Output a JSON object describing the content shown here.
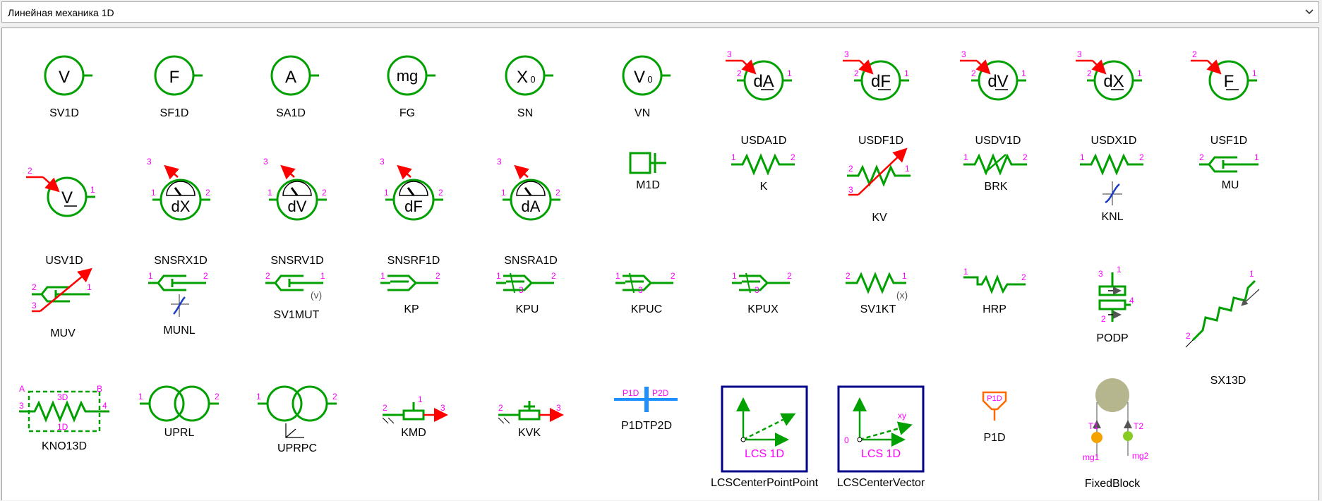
{
  "library_select": {
    "value": "Линейная механика 1D"
  },
  "colors": {
    "wire": "#00a000",
    "pin": "#ff00ff",
    "signal": "#ff0000",
    "frame": "#00008b",
    "lcs": "#ff00ff"
  },
  "components": [
    {
      "label": "SV1D",
      "sym": "V"
    },
    {
      "label": "SF1D",
      "sym": "F"
    },
    {
      "label": "SA1D",
      "sym": "A"
    },
    {
      "label": "FG",
      "sym": "mg"
    },
    {
      "label": "SN",
      "sym": "X",
      "sub": "0"
    },
    {
      "label": "VN",
      "sym": "V",
      "sub": "0"
    },
    {
      "label": "USDA1D",
      "sym": "dA",
      "pins": [
        "3",
        "2",
        "1"
      ]
    },
    {
      "label": "USDF1D",
      "sym": "dF",
      "pins": [
        "3",
        "2",
        "1"
      ]
    },
    {
      "label": "USDV1D",
      "sym": "dV",
      "pins": [
        "3",
        "2",
        "1"
      ]
    },
    {
      "label": "USDX1D",
      "sym": "dX",
      "pins": [
        "3",
        "2",
        "1"
      ]
    },
    {
      "label": "USF1D",
      "sym": "F",
      "pins": [
        "2",
        "1"
      ]
    },
    {
      "label": "USV1D",
      "sym": "V",
      "pins": [
        "2",
        "1"
      ]
    },
    {
      "label": "SNSRX1D",
      "sym": "dX",
      "pins": [
        "3",
        "1",
        "2"
      ]
    },
    {
      "label": "SNSRV1D",
      "sym": "dV",
      "pins": [
        "3",
        "1",
        "2"
      ]
    },
    {
      "label": "SNSRF1D",
      "sym": "dF",
      "pins": [
        "3",
        "1",
        "2"
      ]
    },
    {
      "label": "SNSRA1D",
      "sym": "dA",
      "pins": [
        "3",
        "1",
        "2"
      ]
    },
    {
      "label": "M1D"
    },
    {
      "label": "K",
      "pins": [
        "1",
        "2"
      ]
    },
    {
      "label": "KV",
      "pins": [
        "2",
        "1",
        "3"
      ]
    },
    {
      "label": "BRK",
      "pins": [
        "1",
        "2"
      ]
    },
    {
      "label": "KNL",
      "pins": [
        "1",
        "2"
      ]
    },
    {
      "label": "MU",
      "pins": [
        "2",
        "1"
      ]
    },
    {
      "label": "MUV",
      "pins": [
        "2",
        "1",
        "3"
      ]
    },
    {
      "label": "MUNL",
      "pins": [
        "1",
        "2"
      ]
    },
    {
      "label": "SV1MUT",
      "pins": [
        "2",
        "1"
      ],
      "sym": "(v)"
    },
    {
      "label": "KP",
      "pins": [
        "1",
        "2"
      ]
    },
    {
      "label": "KPU",
      "pins": [
        "1",
        "3",
        "2"
      ]
    },
    {
      "label": "KPUC",
      "pins": [
        "1",
        "3",
        "2"
      ]
    },
    {
      "label": "KPUX",
      "pins": [
        "1",
        "3",
        "2"
      ]
    },
    {
      "label": "SV1KT",
      "pins": [
        "2",
        "1"
      ],
      "sym": "(x)"
    },
    {
      "label": "HRP",
      "pins": [
        "1",
        "2"
      ]
    },
    {
      "label": "PODP",
      "pins": [
        "3",
        "1",
        "4",
        "2"
      ]
    },
    {
      "label": "SX13D",
      "pins": [
        "1",
        "2"
      ]
    },
    {
      "label": "KNO13D",
      "pins": [
        "A",
        "B",
        "3D",
        "3",
        "4",
        "1D"
      ]
    },
    {
      "label": "UPRL",
      "pins": [
        "1",
        "2"
      ]
    },
    {
      "label": "UPRPC",
      "pins": [
        "1",
        "2"
      ]
    },
    {
      "label": "KMD",
      "pins": [
        "2",
        "1",
        "3"
      ]
    },
    {
      "label": "KVK",
      "pins": [
        "2",
        "3"
      ]
    },
    {
      "label": "P1DTP2D",
      "pins": [
        "P1D",
        "P2D"
      ]
    },
    {
      "label": "LCSCenterPointPoint",
      "sym": "LCS 1D"
    },
    {
      "label": "LCSCenterVector",
      "sym": "LCS 1D",
      "pins": [
        "0",
        "xy"
      ]
    },
    {
      "label": "P1D",
      "sym": "P1D"
    },
    {
      "label": "FixedBlock",
      "pins": [
        "T1",
        "T2",
        "mg1",
        "mg2"
      ]
    }
  ]
}
